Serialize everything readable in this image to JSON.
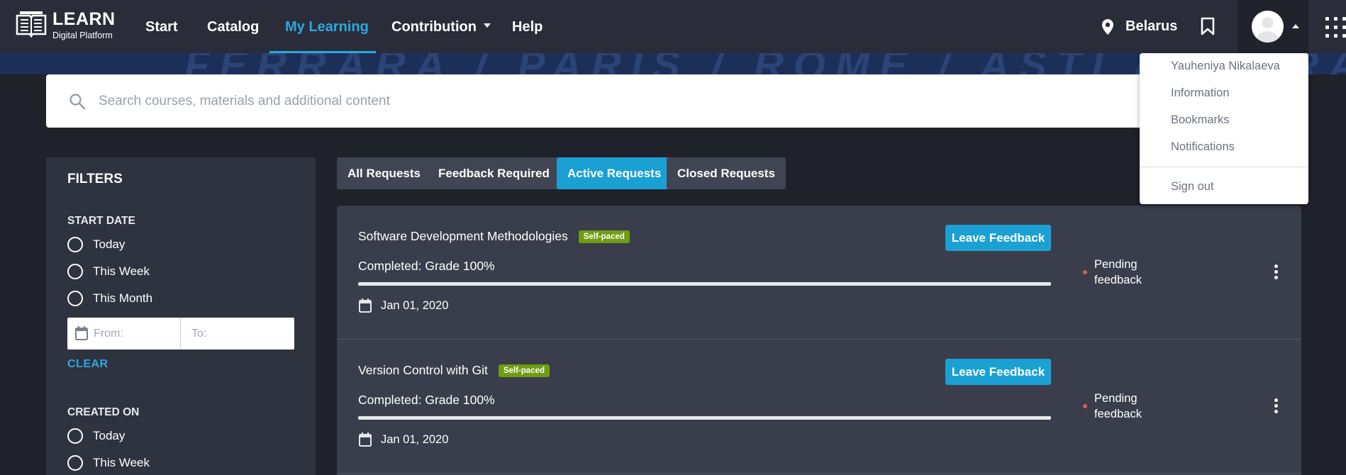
{
  "header": {
    "logo_title": "LEARN",
    "logo_subtitle": "Digital Platform",
    "nav": [
      {
        "label": "Start"
      },
      {
        "label": "Catalog"
      },
      {
        "label": "My Learning"
      },
      {
        "label": "Contribution"
      },
      {
        "label": "Help"
      }
    ],
    "location": "Belarus"
  },
  "banner": {
    "text": "FERRARA / PARIS / ROME / ASTI / FERRARA"
  },
  "search": {
    "placeholder": "Search courses, materials and additional content"
  },
  "filters": {
    "title": "FILTERS",
    "start_date": {
      "heading": "START DATE",
      "options": [
        "Today",
        "This Week",
        "This Month"
      ],
      "from_placeholder": "From:",
      "to_placeholder": "To:",
      "clear_label": "CLEAR"
    },
    "created_on": {
      "heading": "CREATED ON",
      "options": [
        "Today",
        "This Week"
      ]
    }
  },
  "tabs": [
    {
      "label": "All Requests"
    },
    {
      "label": "Feedback Required"
    },
    {
      "label": "Active Requests"
    },
    {
      "label": "Closed Requests"
    }
  ],
  "requests": [
    {
      "title": "Software Development Methodologies",
      "badge": "Self-paced",
      "completed": "Completed: Grade 100%",
      "progress": 1.0,
      "date": "Jan 01, 2020",
      "button": "Leave Feedback",
      "status": "Pending feedback"
    },
    {
      "title": "Version Control with Git",
      "badge": "Self-paced",
      "completed": "Completed: Grade 100%",
      "progress": 1.0,
      "date": "Jan 01, 2020",
      "button": "Leave Feedback",
      "status": "Pending feedback"
    }
  ],
  "user_menu": {
    "items": [
      {
        "label": "Yauheniya Nikalaeva"
      },
      {
        "label": "Information"
      },
      {
        "label": "Bookmarks"
      },
      {
        "label": "Notifications"
      },
      {
        "label": "Sign out"
      }
    ]
  },
  "colors": {
    "accent": "#1ba0d3",
    "badge": "#6e9d12",
    "status_dot": "#e45858"
  }
}
